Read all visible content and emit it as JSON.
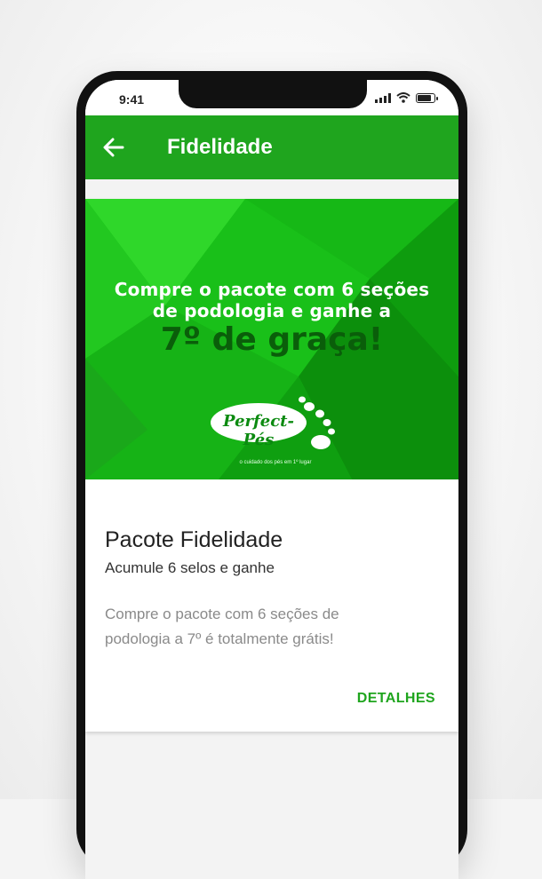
{
  "status_bar": {
    "time": "9:41"
  },
  "app_bar": {
    "title": "Fidelidade",
    "back_icon": "arrow-left-icon"
  },
  "banner": {
    "line1": "Compre o pacote com 6 seções",
    "line2": "de podologia e ganhe a",
    "line3": "7º de graça!",
    "logo_text": "Perfect-Pés",
    "logo_tagline": "o cuidado dos pés em 1º lugar"
  },
  "card": {
    "title": "Pacote Fidelidade",
    "subtitle": "Acumule 6 selos e ganhe",
    "description": "Compre o pacote com 6 seções de podologia a 7º é totalmente grátis!",
    "details_label": "DETALHES"
  },
  "colors": {
    "primary": "#1fa51e",
    "banner_green": "#12c212",
    "headline_dark": "#0a5e0a"
  }
}
